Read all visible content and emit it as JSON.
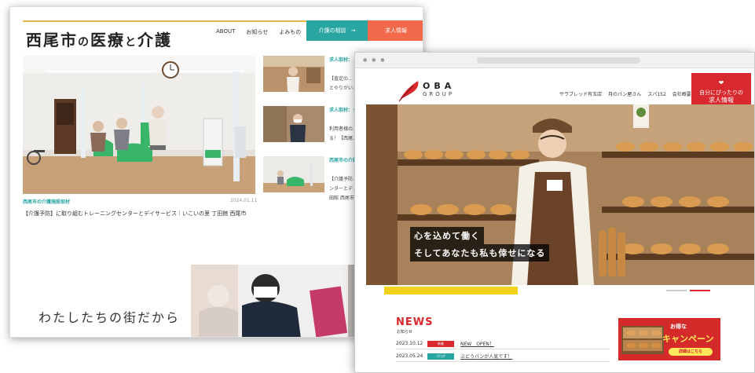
{
  "site1": {
    "logo_main": "西尾市",
    "logo_no": "の",
    "logo_mid": "医療",
    "logo_to": "と",
    "logo_end": "介護",
    "nav": [
      "ABOUT",
      "お知らせ",
      "よみもの"
    ],
    "btn_consult": "介護の相談",
    "btn_consult_arrow": "→",
    "btn_recruit": "求人情報",
    "hero_category": "西尾市の介護施設取材",
    "hero_date": "2024.01.11",
    "hero_title": "【介護予防】に取り組むトレーニングセンターとデイサービス｜いこいの里 丁田館 西尾市",
    "side_items": [
      {
        "tag": "求人取材：",
        "text1": "【査定の…",
        "text2": "とやりがい…"
      },
      {
        "tag": "求人取材：ク",
        "text1": "利用者様の…",
        "text2": "る！【西尾…"
      },
      {
        "tag": "西尾市の介護",
        "text1": "【介護予防…",
        "text2": "ンターとデ…",
        "text3": "田館 西尾市"
      }
    ],
    "footer_text": "わたしたちの街だから"
  },
  "site2": {
    "logo_oba": "OBA",
    "logo_group": "GROUP",
    "nav": [
      "サラブレッド有玉店",
      "月のパン屋さん",
      "スパ152",
      "会社概要"
    ],
    "recruit_line1": "自分にぴったりの",
    "recruit_line2": "求人情報",
    "catch1": "心を込めて働く",
    "catch2": "そしてあなたも私も倖せになる",
    "news_title": "NEWS",
    "news_sub": "お知らせ",
    "news": [
      {
        "date": "2023.10.12",
        "tag": "新着",
        "tag_color": "#d8292f",
        "text": "NEW　OPEN！"
      },
      {
        "date": "2023.05.24",
        "tag": "ブログ",
        "tag_color": "#2aa6a2",
        "text": "ぶどうパンが人気です！"
      }
    ],
    "campaign_small": "お得な",
    "campaign_big": "キャンペーン",
    "campaign_btn": "詳細はこちら"
  },
  "colors": {
    "teal": "#2aa6a2",
    "coral": "#f26a4b",
    "oba_red": "#d8292f",
    "yellow": "#f2d21a"
  }
}
